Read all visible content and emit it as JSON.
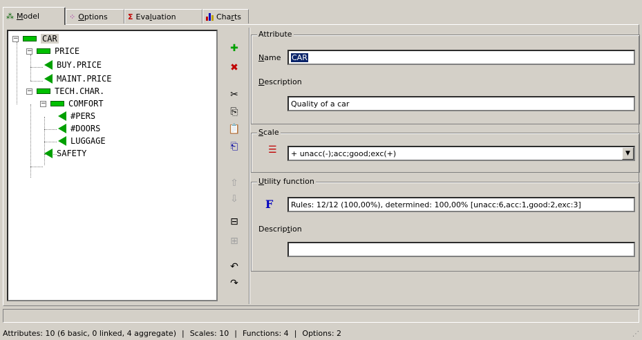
{
  "tabs": [
    {
      "label_pre": "",
      "label_u": "M",
      "label_post": "odel",
      "icon": "model-tree-icon"
    },
    {
      "label_pre": "",
      "label_u": "O",
      "label_post": "ptions",
      "icon": "options-dots-icon"
    },
    {
      "label_pre": "Eva",
      "label_u": "l",
      "label_post": "uation",
      "icon": "sigma-icon"
    },
    {
      "label_pre": "Cha",
      "label_u": "r",
      "label_post": "ts",
      "icon": "bar-chart-icon"
    }
  ],
  "tree": {
    "nodes": [
      "CAR",
      "PRICE",
      "BUY.PRICE",
      "MAINT.PRICE",
      "TECH.CHAR.",
      "COMFORT",
      "#PERS",
      "#DOORS",
      "LUGGAGE",
      "SAFETY"
    ]
  },
  "attribute": {
    "group_title": "Attribute",
    "name_label_u": "N",
    "name_label_rest": "ame",
    "name_value": "CAR",
    "desc_label_u": "D",
    "desc_label_rest": "escription",
    "desc_value": "Quality of a car"
  },
  "scale": {
    "group_title_u": "S",
    "group_title_rest": "cale",
    "value": "+ unacc(-);acc;good;exc(+)"
  },
  "utility": {
    "group_title_u": "U",
    "group_title_rest": "tility function",
    "icon_letter": "F",
    "rules_value": "Rules: 12/12 (100,00%), determined: 100,00% [unacc:6,acc:1,good:2,exc:3]",
    "desc_label_pre": "Descrip",
    "desc_label_u": "t",
    "desc_label_post": "ion",
    "desc_value": ""
  },
  "status": {
    "attributes": "Attributes: 10 (6 basic, 0 linked, 4 aggregate)",
    "sep": "|",
    "scales": "Scales: 10",
    "functions": "Functions: 4",
    "options": "Options: 2"
  },
  "colors": {
    "aggregate_node": "#00c000",
    "basic_node": "#00a000",
    "selection": "#0a246a"
  }
}
